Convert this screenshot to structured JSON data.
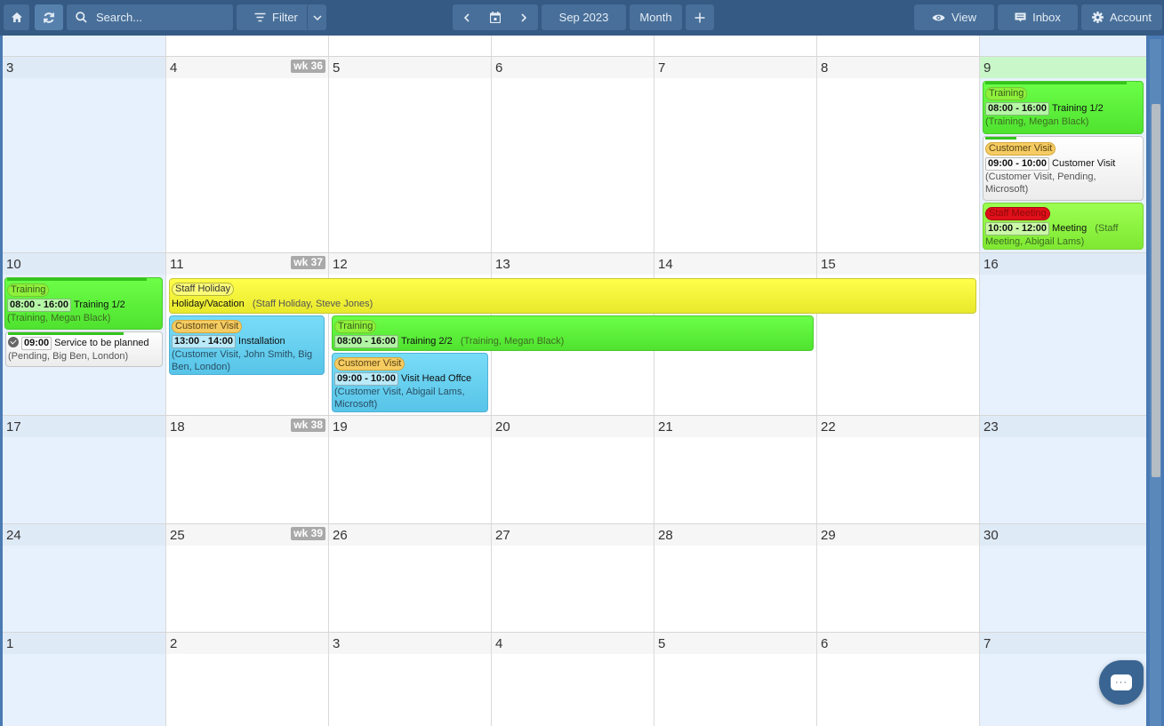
{
  "toolbar": {
    "home_icon": "home-icon",
    "refresh_icon": "refresh-icon",
    "search": {
      "placeholder": "Search..."
    },
    "filter_label": "Filter",
    "prev_icon": "chevron-left-icon",
    "today_icon": "calendar-icon",
    "next_icon": "chevron-right-icon",
    "period_label": "Sep 2023",
    "view_mode_label": "Month",
    "add_icon": "plus-icon",
    "view_label": "View",
    "inbox_label": "Inbox",
    "account_label": "Account"
  },
  "calendar": {
    "month": "Sep 2023",
    "weeks": [
      {
        "week_label": "",
        "days": [
          "",
          "",
          "",
          "",
          "",
          "",
          ""
        ]
      },
      {
        "week_label": "wk 36",
        "days": [
          "3",
          "4",
          "5",
          "6",
          "7",
          "8",
          "9"
        ]
      },
      {
        "week_label": "wk 37",
        "days": [
          "10",
          "11",
          "12",
          "13",
          "14",
          "15",
          "16"
        ]
      },
      {
        "week_label": "wk 38",
        "days": [
          "17",
          "18",
          "19",
          "20",
          "21",
          "22",
          "23"
        ]
      },
      {
        "week_label": "wk 39",
        "days": [
          "24",
          "25",
          "26",
          "27",
          "28",
          "29",
          "30"
        ]
      },
      {
        "week_label": "",
        "days": [
          "1",
          "2",
          "3",
          "4",
          "5",
          "6",
          "7"
        ]
      }
    ],
    "events": [
      {
        "id": "e1",
        "day": "Sep 9",
        "category": "Training",
        "time": "08:00 - 16:00",
        "title": "Training 1/2",
        "meta": "(Training, Megan Black)",
        "progress": 0.9
      },
      {
        "id": "e2",
        "day": "Sep 9",
        "category": "Customer Visit",
        "time": "09:00 - 10:00",
        "title": "Customer Visit",
        "meta": "(Customer Visit, Pending, Microsoft)",
        "progress": 0.2
      },
      {
        "id": "e3",
        "day": "Sep 9",
        "category": "Staff Meeting",
        "time": "10:00 - 12:00",
        "title": "Meeting",
        "meta": "(Staff Meeting, Abigail Lams)"
      },
      {
        "id": "e4",
        "day": "Sep 10",
        "category": "Training",
        "time": "08:00 - 16:00",
        "title": "Training 1/2",
        "meta": "(Training, Megan Black)",
        "progress": 0.9
      },
      {
        "id": "e5",
        "day": "Sep 10",
        "category": "",
        "time": "09:00",
        "title": "Service to be planned",
        "meta": "(Pending, Big Ben, London)",
        "progress": 0.75,
        "status_icon": "check-circle-icon"
      },
      {
        "id": "e6",
        "day": "Sep 11 - Sep 15",
        "category": "Staff Holiday",
        "time": "",
        "title": "Holiday/Vacation",
        "meta": "(Staff Holiday, Steve Jones)"
      },
      {
        "id": "e7",
        "day": "Sep 11",
        "category": "Customer Visit",
        "time": "13:00 - 14:00",
        "title": "Installation",
        "meta": "(Customer Visit, John Smith, Big Ben, London)"
      },
      {
        "id": "e8",
        "day": "Sep 12 - Sep 14",
        "category": "Training",
        "time": "08:00 - 16:00",
        "title": "Training 2/2",
        "meta": "(Training, Megan Black)"
      },
      {
        "id": "e9",
        "day": "Sep 12",
        "category": "Customer Visit",
        "time": "09:00 - 10:00",
        "title": "Visit Head Offce",
        "meta": "(Customer Visit, Abigail Lams, Microsoft)"
      }
    ]
  },
  "chat": {
    "icon": "chat-bubble-icon",
    "dots": "···"
  },
  "colors": {
    "toolbar_bg": "#355a84",
    "button_bg": "#486f99",
    "weekend_bg": "#e6f1fd",
    "today_header": "#c9f7c9",
    "training": "#6cff48",
    "customer_visit": "#78dcf7",
    "staff_holiday": "#ffff4c",
    "staff_meeting_tag": "#e0101a"
  }
}
